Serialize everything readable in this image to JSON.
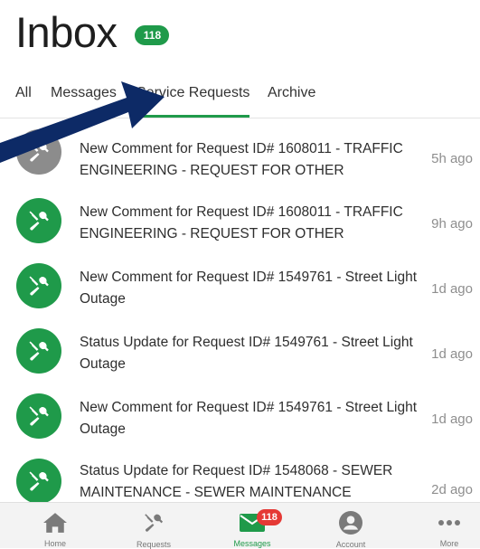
{
  "header": {
    "title": "Inbox",
    "badge": "118"
  },
  "tabs": [
    {
      "label": "All"
    },
    {
      "label": "Messages"
    },
    {
      "label": "Service Requests",
      "active": true
    },
    {
      "label": "Archive"
    }
  ],
  "items": [
    {
      "title": "New Comment for Request ID# 1608011 - TRAFFIC ENGINEERING - REQUEST FOR OTHER",
      "time": "5h ago",
      "icon": "wrench-screwdriver-icon",
      "icon_color": "#8c8c8c"
    },
    {
      "title": "New Comment for Request ID# 1608011 - TRAFFIC ENGINEERING - REQUEST FOR OTHER",
      "time": "9h ago",
      "icon": "wrench-screwdriver-icon",
      "icon_color": "#1f9a4a"
    },
    {
      "title": "New Comment for Request ID# 1549761 - Street Light Outage",
      "time": "1d ago",
      "icon": "wrench-screwdriver-icon",
      "icon_color": "#1f9a4a"
    },
    {
      "title": "Status Update for Request ID# 1549761 - Street Light Outage",
      "time": "1d ago",
      "icon": "wrench-screwdriver-icon",
      "icon_color": "#1f9a4a"
    },
    {
      "title": "New Comment for Request ID# 1549761 - Street Light Outage",
      "time": "1d ago",
      "icon": "wrench-screwdriver-icon",
      "icon_color": "#1f9a4a"
    },
    {
      "title": "Status Update for Request ID# 1548068 - SEWER MAINTENANCE - SEWER MAINTENANCE",
      "time": "2d ago",
      "icon": "wrench-screwdriver-icon",
      "icon_color": "#1f9a4a"
    }
  ],
  "bottom_nav": [
    {
      "label": "Home",
      "icon": "home-icon"
    },
    {
      "label": "Requests",
      "icon": "wrench-screwdriver-icon"
    },
    {
      "label": "Messages",
      "icon": "envelope-icon",
      "badge": "118",
      "active": true
    },
    {
      "label": "Account",
      "icon": "person-icon"
    },
    {
      "label": "More",
      "icon": "more-dots-icon"
    }
  ],
  "colors": {
    "accent": "#1f9a4a",
    "badge_red": "#e53935",
    "annotation_arrow": "#0d2a66"
  }
}
